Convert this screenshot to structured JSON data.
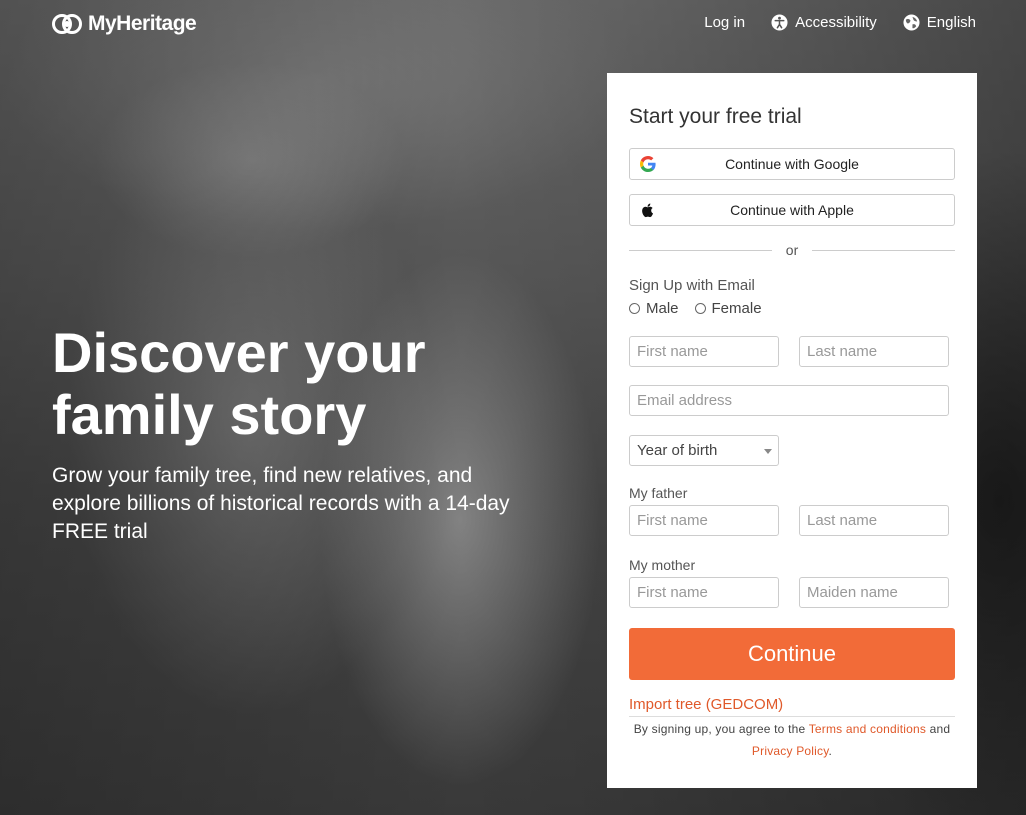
{
  "brand": {
    "name": "MyHeritage"
  },
  "nav": {
    "login": "Log in",
    "accessibility": "Accessibility",
    "language": "English"
  },
  "hero": {
    "title_line1": "Discover your",
    "title_line2": "family story",
    "subtitle": "Grow your family tree, find new relatives, and explore billions of historical records with a 14-day FREE trial"
  },
  "form": {
    "title": "Start your free trial",
    "google": "Continue with Google",
    "apple": "Continue with Apple",
    "or": "or",
    "signup_email": "Sign Up with Email",
    "gender_male": "Male",
    "gender_female": "Female",
    "first_name_placeholder": "First name",
    "last_name_placeholder": "Last name",
    "email_placeholder": "Email address",
    "year_of_birth": "Year of birth",
    "father_label": "My father",
    "father_first_placeholder": "First name",
    "father_last_placeholder": "Last name",
    "mother_label": "My mother",
    "mother_first_placeholder": "First name",
    "mother_maiden_placeholder": "Maiden name",
    "continue": "Continue",
    "import": "Import tree (GEDCOM)",
    "terms_prefix": "By signing up, you agree to the",
    "terms_link": "Terms and conditions",
    "terms_and": "and",
    "privacy_link": "Privacy Policy",
    "terms_suffix": "."
  },
  "colors": {
    "accent": "#f26b38",
    "link": "#e0592a"
  }
}
